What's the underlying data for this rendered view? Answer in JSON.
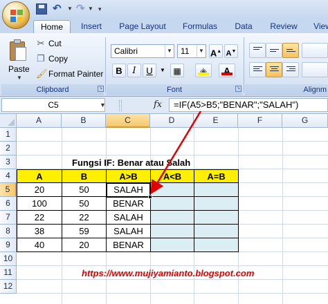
{
  "quick_access": {
    "undo_glyph": "↶",
    "redo_glyph": "↷"
  },
  "tabs": [
    "Home",
    "Insert",
    "Page Layout",
    "Formulas",
    "Data",
    "Review",
    "View"
  ],
  "clipboard": {
    "paste": "Paste",
    "cut": "Cut",
    "copy": "Copy",
    "format_painter": "Format Painter",
    "group_label": "Clipboard"
  },
  "font": {
    "name": "Calibri",
    "size": "11",
    "grow": "A",
    "shrink": "A",
    "bold": "B",
    "italic": "I",
    "underline": "U",
    "font_color_letter": "A",
    "group_label": "Font"
  },
  "alignment": {
    "group_label": "Alignm"
  },
  "formula_bar": {
    "name_box": "C5",
    "fx": "fx",
    "formula": "=IF(A5>B5;\"BENAR\";\"SALAH\")"
  },
  "columns": [
    "A",
    "B",
    "C",
    "D",
    "E",
    "F",
    "G"
  ],
  "rows": [
    "1",
    "2",
    "3",
    "4",
    "5",
    "6",
    "7",
    "8",
    "9",
    "10",
    "11",
    "12"
  ],
  "sheet": {
    "title": "Fungsi IF: Benar atau Salah",
    "table_headers": [
      "A",
      "B",
      "A>B",
      "A<B",
      "A=B"
    ],
    "table_rows": [
      [
        "20",
        "50",
        "SALAH",
        "",
        ""
      ],
      [
        "100",
        "50",
        "BENAR",
        "",
        ""
      ],
      [
        "22",
        "22",
        "SALAH",
        "",
        ""
      ],
      [
        "38",
        "59",
        "SALAH",
        "",
        ""
      ],
      [
        "40",
        "20",
        "BENAR",
        "",
        ""
      ]
    ],
    "link": "https://www.mujiyamianto.blogspot.com"
  },
  "colors": {
    "header_fill": "#ffef00",
    "light_fill": "#daeef3",
    "arrow": "#e00000",
    "link": "#e00000"
  },
  "icons": [
    "office-button-icon",
    "save-icon",
    "undo-icon",
    "redo-icon",
    "paste-icon",
    "cut-icon",
    "copy-icon",
    "format-painter-icon",
    "fill-color-icon",
    "font-color-icon",
    "align-top-icon",
    "align-middle-icon",
    "align-bottom-icon",
    "align-left-icon",
    "align-center-icon",
    "align-right-icon",
    "fx-icon"
  ]
}
